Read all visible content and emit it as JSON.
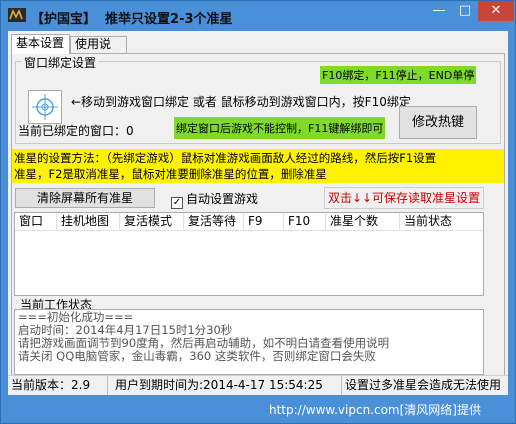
{
  "window": {
    "title": "【护国宝】  推举只设置2-3个准星",
    "min": "—",
    "max": "□",
    "close": "✕"
  },
  "tabs": [
    {
      "label": "基本设置",
      "active": true
    },
    {
      "label": "使用说明",
      "active": false
    }
  ],
  "bind_group": {
    "label": "窗口绑定设置",
    "hotkeys_hint": "F10绑定，F11停止，END单停",
    "move_hint": "←移动到游戏窗口绑定 或者 鼠标移动到游戏窗口内，按F10绑定",
    "warning": "绑定窗口后游戏不能控制，F11键解绑即可",
    "bound_window_label": "当前已绑定的窗口：",
    "bound_window_value": "0",
    "modify_hotkey_button": "修改热键"
  },
  "instructions": {
    "line1": "准星的设置方法：（先绑定游戏）鼠标对准游戏画面敌人经过的路线，然后按F1设置",
    "line2": "准星，F2是取消准星，鼠标对准要删除准星的位置，删除准星"
  },
  "controls": {
    "clear_button": "清除屏幕所有准星",
    "auto_setup_label": "自动设置游戏",
    "auto_setup_checked": true,
    "save_button": "双击↓↓可保存读取准星设置"
  },
  "table": {
    "columns": [
      "窗口",
      "挂机地图",
      "复活模式",
      "复活等待",
      "F9",
      "F10",
      "准星个数",
      "当前状态"
    ],
    "rows": []
  },
  "status_group": {
    "label": "当前工作状态",
    "lines": [
      "===初始化成功===",
      "启动时间：2014年4月17日15时1分30秒",
      "请把游戏画面调节到90度角，然后再启动辅助，如不明白请查看使用说明",
      "请关闭 QQ电脑管家，金山毒霸，360 这类软件，否则绑定窗口会失败"
    ]
  },
  "statusbar": {
    "version": "当前版本：2.9",
    "expiry": "用户到期时间为:2014-4-17 15:54:25",
    "warning": "设置过多准星会造成无法使用"
  },
  "watermark": "http://www.vipcn.com[清风网络]提供",
  "colors": {
    "title_bar": "#4a90d9",
    "green_highlight": "#7fda2a",
    "yellow_panel": "#fff200",
    "save_text": "#cc0000"
  }
}
